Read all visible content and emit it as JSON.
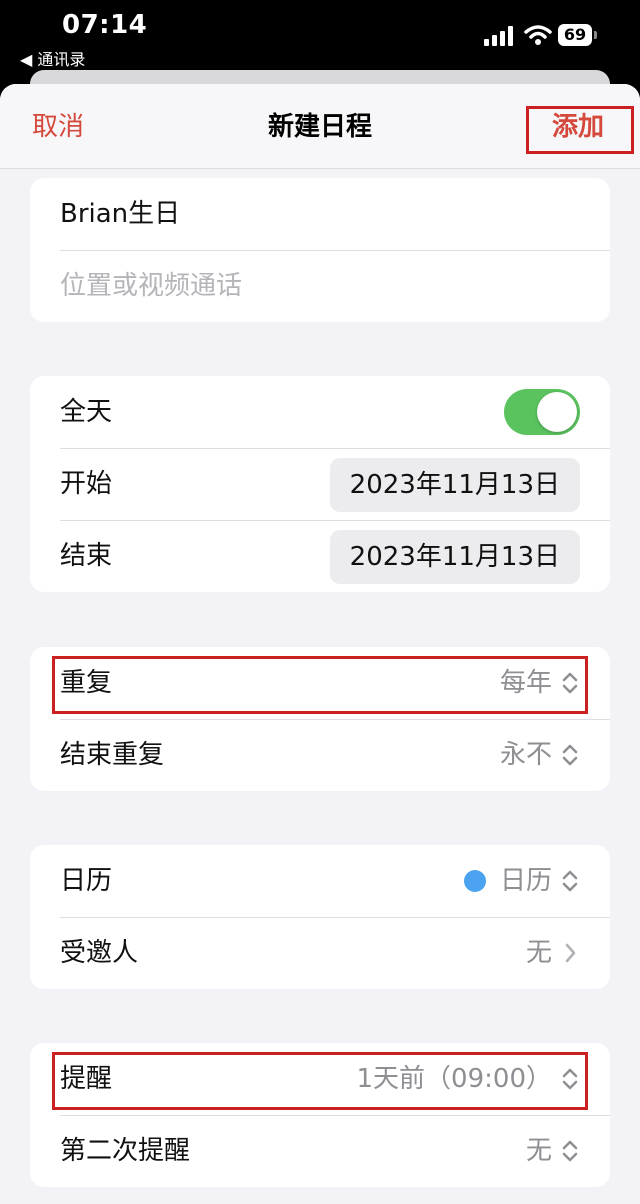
{
  "status_bar": {
    "time": "07:14",
    "back_app": "◀ 通讯录",
    "battery": "69"
  },
  "nav": {
    "cancel": "取消",
    "title": "新建日程",
    "add": "添加"
  },
  "event": {
    "title": "Brian生日",
    "location_placeholder": "位置或视频通话"
  },
  "time_group": {
    "all_day_label": "全天",
    "all_day": true,
    "start_label": "开始",
    "start_date": "2023年11月13日",
    "end_label": "结束",
    "end_date": "2023年11月13日"
  },
  "repeat_group": {
    "repeat_label": "重复",
    "repeat_value": "每年",
    "end_repeat_label": "结束重复",
    "end_repeat_value": "永不"
  },
  "calendar_group": {
    "calendar_label": "日历",
    "calendar_value": "日历",
    "calendar_color": "#4ba3ef",
    "invitees_label": "受邀人",
    "invitees_value": "无"
  },
  "alert_group": {
    "alert_label": "提醒",
    "alert_value": "1天前（09:00）",
    "second_alert_label": "第二次提醒",
    "second_alert_value": "无"
  },
  "colors": {
    "accent": "#d4493c",
    "toggle_on": "#5ac35e",
    "highlight": "#cc1f1f"
  }
}
